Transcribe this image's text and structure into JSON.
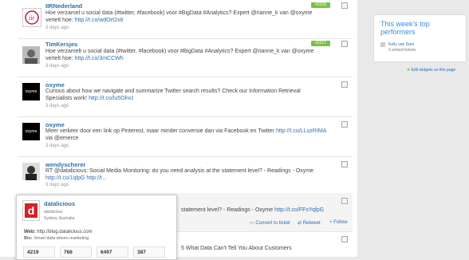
{
  "stream": {
    "items": [
      {
        "author": "IIRNederland",
        "text": "Hoe verzamel u social data (#twitter, #facebook) voor #BigData #Analytics? Expert @rianne_k van @oxyme vertelt hoe:",
        "link": "http://t.co/wdOrt2x8",
        "time": "3 days ago",
        "tag": "#2218"
      },
      {
        "author": "TimKersjes",
        "text": "Hoe verzamelt u social data (#twitter, #facebook) voor #BigData #Analytics? Expert @rianne_k van @oxyme vertelt hoe:",
        "link": "http://t.co/3mCCWh",
        "time": "3 days ago",
        "tag": "#2217"
      },
      {
        "author": "oxyme",
        "text": "Curious about how we navigate and summarize Twitter search results? Check our Information Retrieval Specialists work!",
        "link": "http://t.co/lu5OlncI",
        "time": "3 days ago"
      },
      {
        "author": "oxyme",
        "text": "Meer verkeer door een link op Pinterest, maar minder conversie dan via Facebook en Twitter",
        "link": "http://t.co/LLuzRIMA",
        "text2": "via @emerce",
        "time": "3 days ago"
      },
      {
        "author": "wendyscherer",
        "text": "RT @datalicious: Social Media Monitoring: do you need analysis at the statement level? - Readings - Oxyme",
        "link": "http://t.co/1qlpG",
        "link2": "http://t...",
        "time": "3 days ago"
      },
      {
        "text": "statement level? - Readings - Oxyme",
        "link": "http://t.co/FFsYqfpG",
        "time": "...days ago"
      },
      {
        "text": "5 What Data Can't Tell You About Customers"
      }
    ],
    "actions": {
      "convert": "Convert to ticket",
      "retweet": "Retweet",
      "follow": "Follow"
    }
  },
  "popup": {
    "name": "datalicious",
    "handle": "datalicious",
    "location": "Sydney, Australia",
    "web_label": "Web:",
    "web": "http://blog.datalicious.com",
    "bio_label": "Bio:",
    "bio": "Smart data driven marketing",
    "stats": [
      "4219",
      "766",
      "6497",
      "387"
    ],
    "logo_letter": "d"
  },
  "sidebar": {
    "panel_title": "This week's top performers",
    "performer_name": "Kelly van Dam",
    "performer_detail": "3 solved tickets",
    "edit_widgets": "Edit widgets on this page"
  },
  "colors": {
    "link": "#2c6fad",
    "tag": "#7ac143",
    "panel_title": "#3a8dde"
  }
}
